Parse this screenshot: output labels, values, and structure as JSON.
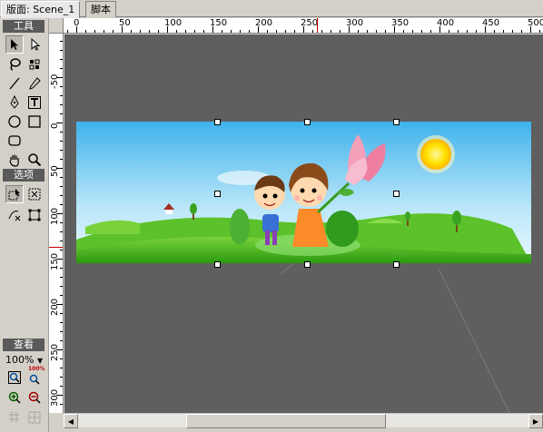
{
  "tabs": [
    {
      "label": "版面: Scene_1",
      "active": true
    },
    {
      "label": "脚本",
      "active": false
    }
  ],
  "toolpanel": {
    "tools_header": "工具",
    "options_header": "选项",
    "view_header": "查看",
    "zoom_value": "100%",
    "zoom_badge": "100%",
    "tools": [
      "arrow-icon",
      "subselect-icon",
      "lasso-icon",
      "transform-icon",
      "line-icon",
      "pencil-icon",
      "pen-icon",
      "text-icon",
      "oval-icon",
      "rectangle-icon",
      "rounded-rect-icon",
      "hand-icon",
      "zoom-icon"
    ]
  },
  "rulers": {
    "top_labels": [
      "0",
      "50",
      "100",
      "150",
      "200",
      "250",
      "300",
      "350",
      "400",
      "450",
      "500"
    ],
    "left_labels": [
      "-50",
      "0",
      "50",
      "100",
      "150",
      "200",
      "250",
      "300"
    ]
  },
  "colors": {
    "panel": "#d4d0c8",
    "workarea": "#5f5f5f",
    "header": "#5a5a5a",
    "ruler_marker": "#c00000",
    "sky": "#4fb8e8",
    "grass": "#3cae1c"
  }
}
